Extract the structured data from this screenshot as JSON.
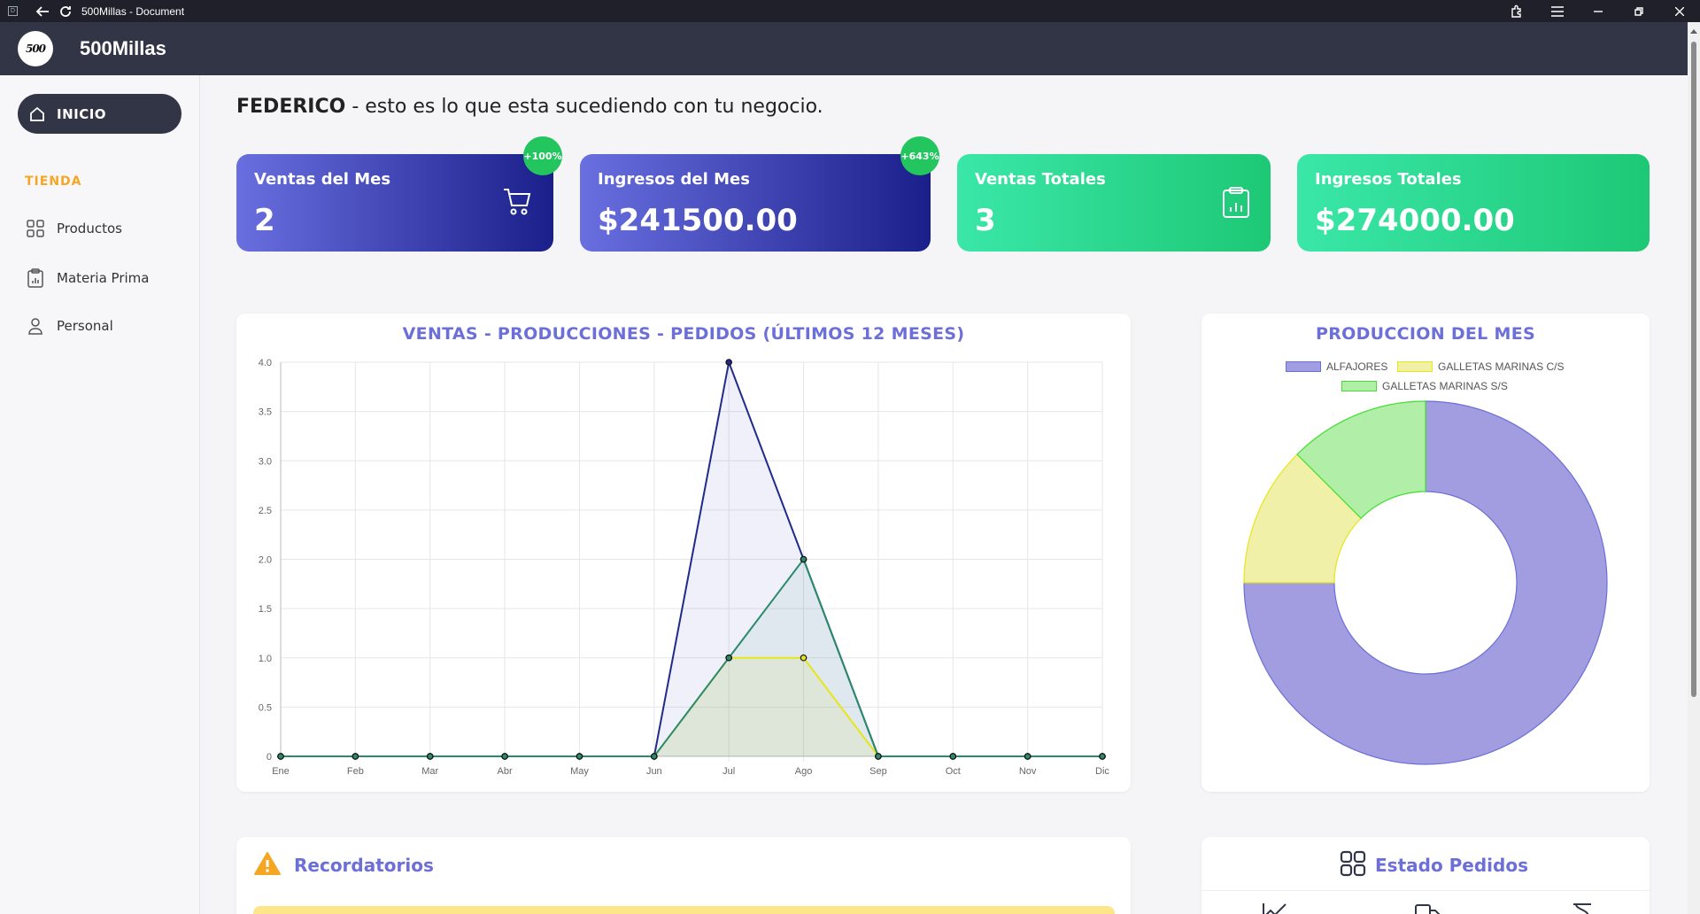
{
  "window": {
    "title": "500Millas - Document"
  },
  "header": {
    "logo_text": "500",
    "brand": "500Millas"
  },
  "sidebar": {
    "home_label": "INICIO",
    "section_title": "TIENDA",
    "items": [
      {
        "label": "Productos",
        "icon": "grid-icon"
      },
      {
        "label": "Materia Prima",
        "icon": "clipboard-chart-icon"
      },
      {
        "label": "Personal",
        "icon": "user-icon"
      }
    ]
  },
  "greeting": {
    "name": "FEDERICO",
    "text": " - esto es lo que esta sucediendo con tu negocio."
  },
  "cards": [
    {
      "label": "Ventas del Mes",
      "value": "2",
      "badge": "+100%",
      "icon": "cart-icon",
      "style": "blue"
    },
    {
      "label": "Ingresos del Mes",
      "value": "$241500.00",
      "badge": "+643%",
      "icon": "",
      "style": "blue"
    },
    {
      "label": "Ventas Totales",
      "value": "3",
      "badge": "",
      "icon": "clipboard-chart-icon",
      "style": "green"
    },
    {
      "label": "Ingresos Totales",
      "value": "$274000.00",
      "badge": "",
      "icon": "",
      "style": "green"
    }
  ],
  "line_chart_title": "VENTAS - PRODUCCIONES - PEDIDOS (ÚLTIMOS 12 MESES)",
  "donut_title": "PRODUCCION DEL MES",
  "reminders_title": "Recordatorios",
  "orders_title": "Estado Pedidos",
  "colors": {
    "accent": "#6c6fd8",
    "dark": "#323545",
    "green": "#22c55e",
    "orange": "#f5a623"
  },
  "chart_data": [
    {
      "type": "line",
      "categories": [
        "Ene",
        "Feb",
        "Mar",
        "Abr",
        "May",
        "Jun",
        "Jul",
        "Ago",
        "Sep",
        "Oct",
        "Nov",
        "Dic"
      ],
      "series": [
        {
          "values": [
            0,
            0,
            0,
            0,
            0,
            0,
            4,
            2,
            0,
            0,
            0,
            0
          ],
          "color": "#1f2a8a"
        },
        {
          "values": [
            0,
            0,
            0,
            0,
            0,
            0,
            1,
            1,
            0,
            0,
            0,
            0
          ],
          "color": "#e6e619"
        },
        {
          "values": [
            0,
            0,
            0,
            0,
            0,
            0,
            1,
            2,
            0,
            0,
            0,
            0
          ],
          "color": "#2a8a6a"
        }
      ],
      "ylim": [
        0,
        4
      ],
      "yticks": [
        "0",
        "0.5",
        "1.0",
        "1.5",
        "2.0",
        "2.5",
        "3.0",
        "3.5",
        "4.0"
      ],
      "grid": true
    },
    {
      "type": "pie",
      "labels": [
        "ALFAJORES",
        "GALLETAS MARINAS C/S",
        "GALLETAS MARINAS S/S"
      ],
      "values": [
        75,
        12.5,
        12.5
      ],
      "colors": [
        "#a29de0",
        "#f0f0a8",
        "#b1efa8"
      ],
      "borders": [
        "#6c6fd8",
        "#e6e619",
        "#44dd33"
      ],
      "legend": "top"
    }
  ]
}
